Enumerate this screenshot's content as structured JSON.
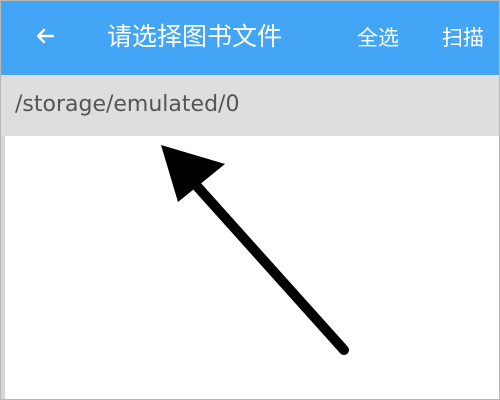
{
  "header": {
    "title": "请选择图书文件",
    "actions": {
      "select_all": "全选",
      "scan": "扫描"
    },
    "icons": {
      "back": "arrow-left-icon"
    }
  },
  "path": {
    "current": "/storage/emulated/0"
  },
  "colors": {
    "header_bg": "#42a5f5",
    "path_bar_bg": "#dedede",
    "content_bg": "#ffffff",
    "arrow": "#000000"
  },
  "annotation": {
    "icon": "arrow-up-left-icon"
  }
}
